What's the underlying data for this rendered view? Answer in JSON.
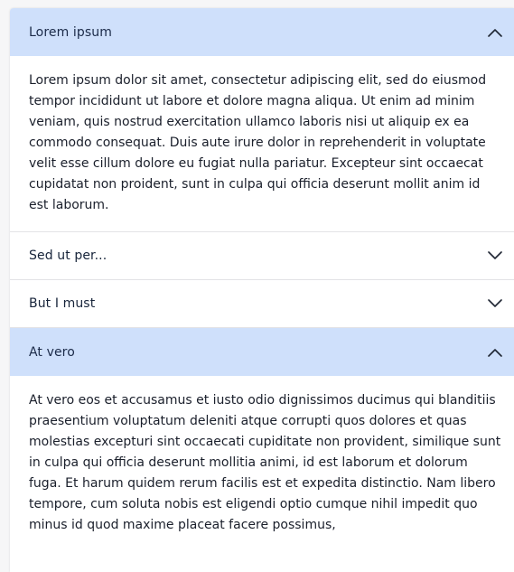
{
  "accordion": {
    "items": [
      {
        "title": "Lorem ipsum",
        "expanded": true,
        "icon": "chevron-up-icon",
        "body": "Lorem ipsum dolor sit amet, consectetur adipiscing elit, sed do eiusmod tempor incididunt ut labore et dolore magna aliqua. Ut enim ad minim veniam, quis nostrud exercitation ullamco laboris nisi ut aliquip ex ea commodo consequat. Duis aute irure dolor in reprehenderit in voluptate velit esse cillum dolore eu fugiat nulla pariatur. Excepteur sint occaecat cupidatat non proident, sunt in culpa qui officia deserunt mollit anim id est laborum."
      },
      {
        "title": "Sed ut per...",
        "expanded": false,
        "icon": "chevron-down-icon"
      },
      {
        "title": "But I must",
        "expanded": false,
        "icon": "chevron-down-icon"
      },
      {
        "title": "At vero",
        "expanded": true,
        "icon": "chevron-up-icon",
        "body": "At vero eos et accusamus et iusto odio dignissimos ducimus qui blanditiis praesentium voluptatum deleniti atque corrupti quos dolores et quas molestias excepturi sint occaecati cupiditate non provident, similique sunt in culpa qui officia deserunt mollitia animi, id est laborum et dolorum fuga. Et harum quidem rerum facilis est et expedita distinctio. Nam libero tempore, cum soluta nobis est eligendi optio cumque nihil impedit quo minus id quod maxime placeat facere possimus,"
      }
    ]
  },
  "colors": {
    "expanded_header_bg": "#cfe0fb",
    "text": "#1a1f2b",
    "divider": "#e3e3e6"
  }
}
